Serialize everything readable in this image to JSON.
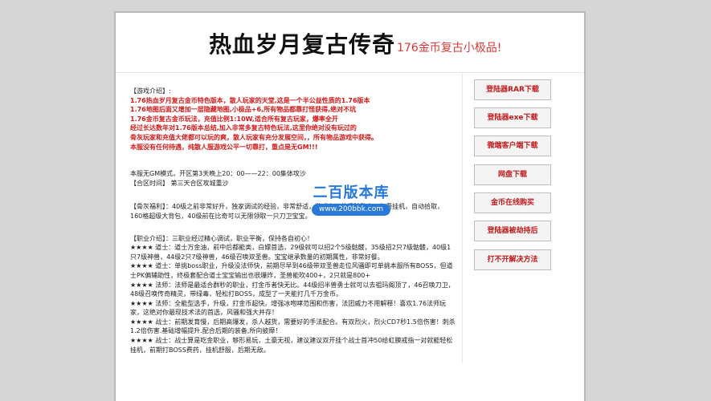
{
  "header": {
    "title": "热血岁月复古传奇",
    "subtitle": "176金币复古小极品!"
  },
  "intro": {
    "heading": "【游戏介绍】:",
    "lines": [
      "1.76热血岁月复古金币特色版本，散人玩家的天堂,这是一个半公益性质的1.76版本",
      "1.76地图后面又增加一层隐藏地图,小极品+6,所有物品都靠打怪获得,绝对不坑",
      "1.76金币复古金币玩法，充值比例1:10W,适合所有复古玩家，爆率全开",
      "经过长达数年对1.76版本总结,加入非常多复古特色玩法,这里你绝对没有玩过的",
      "骨灰玩家和充值大佬都可以玩的爽，散人玩家有充分发展空间，，所有物品游戏中获得。",
      "本服没有任何待遇，纯散人服游戏公平一切靠打，重点是无GM!!!"
    ]
  },
  "schedule": {
    "line1": "本服无GM模式，开区第3天晚上20：00——22：00集体攻沙",
    "line2": "【合区时间】 第三天合区攻城重沙"
  },
  "logo": {
    "name": "二百版本库",
    "url": "www.200bbk.com"
  },
  "benefits": {
    "text": "【骨灰福利】：40级之前非常好升，独家调试的经验，非常舒适，游戏有双倍经验勋章！免费挂机，自动拾取，160格超级大背包，40级前在比奇可以无限领取一只刀卫宝宝。"
  },
  "classes": {
    "heading": "【职业介绍】：三职业经过精心调试，职业平衡，保持各自初心！",
    "lines": [
      "★★★★ 道士：道士万金油，前中后都能类，白嫖首选，29级就可以招2个5级骷髅，35级招2只7级骷髅，40级1只7级神兽，44级2只7级神兽，46级召唤双圣兽。宝宝继承数量的初期属性，非常好餐。",
      "★★★★ 道士：单挑boss职业，升级没法师快，前期尽早到46级带双圣兽走位风骚即可单挑本服所有BOSS，但道士PK偏辅助性，终极套配合道士宝宝输出也很爆炸，圣兽能吹400+，2只就是800+",
      "★★★★ 法师：法师是最适合群秒的职业，打金币者快无比。44级招半兽勇士就可以去祖玛阁顶了，46召唤刀卫，48级召唤传奇精灵，带绿毒，轻松打BOSS，成型了一天能打几千万金币。",
      "★★★★ 法师：全能型选手，升级，打金币超快。增强冰咆哮范围和伤害，法团威力不用解释！喜欢1.76法师玩家，这绝对你最现技术法的首选，风骚和强大并存！",
      "★★★★ 战士：前期发育慢，后期高爆发，杀人越货，需要好的手法配合。有双烈火，烈火CD7秒1.5倍伤害！刺杀1.2倍伤害.基础增幅提升.配合后期的装备,所向披靡！",
      "★★★★ 战士：战士算是吃金职业，够形易玩，土豪无视，建议建议双开挂个战士首冲50给虹膜戒指一对就能轻松挂机，前期打BOSS费药，挂机舒服，后期无敌。"
    ]
  },
  "sidebar": {
    "buttons": [
      "登陆器RAR下载",
      "登陆器exe下载",
      "微端客户端下载",
      "网盘下载",
      "金币在线购买",
      "登陆器被劫持后",
      "打不开解决方法"
    ]
  }
}
